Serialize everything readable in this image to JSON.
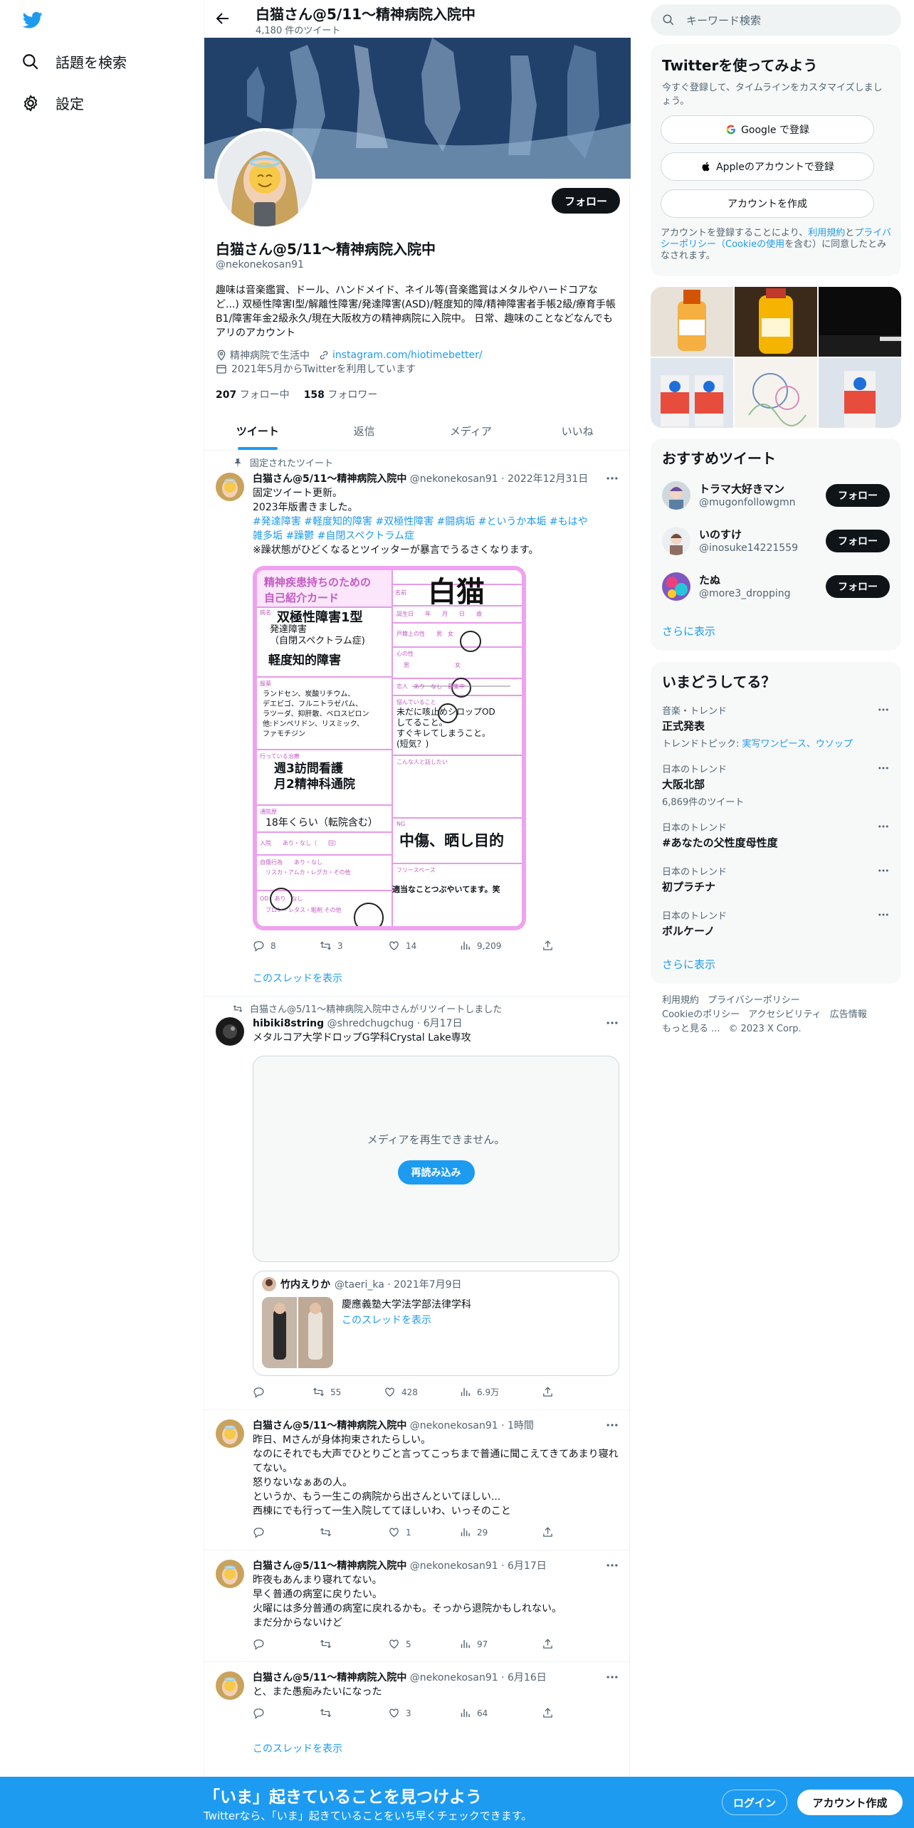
{
  "colors": {
    "accent": "#1d9bf0",
    "text": "#0f1419",
    "muted": "#536471",
    "card_pink": "#f0a2f0"
  },
  "nav": {
    "logo_icon": "twitter-bird-icon",
    "items": [
      {
        "label": "話題を検索",
        "icon": "search-icon"
      },
      {
        "label": "設定",
        "icon": "gear-icon"
      }
    ]
  },
  "header": {
    "title": "白猫さん@5/11〜精神病院入院中",
    "tweet_count": "4,180 件のツイート"
  },
  "profile": {
    "follow": "フォロー",
    "name": "白猫さん@5/11〜精神病院入院中",
    "handle": "@nekonekosan91",
    "bio": "趣味は音楽鑑賞、ドール、ハンドメイド、ネイル等(音楽鑑賞はメタルやハードコアなど...) 双極性障害Ⅰ型/解離性障害/発達障害(ASD)/軽度知的障/精神障害者手帳2級/療育手帳B1/障害年金2級永久/現在大阪枚方の精神病院に入院中。 日常、趣味のことなどなんでもアリのアカウント",
    "location": "精神病院で生活中",
    "link": "instagram.com/hiotimebetter/",
    "joined": "2021年5月からTwitterを利用しています",
    "following_count": "207",
    "following_label": "フォロー中",
    "followers_count": "158",
    "followers_label": "フォロワー"
  },
  "tabs": [
    "ツイート",
    "返信",
    "メディア",
    "いいね"
  ],
  "tweets": [
    {
      "pinned": "固定されたツイート",
      "name": "白猫さん@5/11〜精神病院入院中",
      "meta": "@nekonekosan91 · 2022年12月31日",
      "line1": "固定ツイート更新。",
      "line2": "2023年版書きました。",
      "tags1": "#発達障害 #軽度知的障害 #双極性障害 #闘病垢 #というか本垢 #もはや",
      "tags2": "雑多垢 #躁鬱 #自閉スペクトラム症",
      "line3": "※躁状態がひどくなるとツイッターが暴言でうるさくなります。",
      "replies": "8",
      "retweets": "3",
      "likes": "14",
      "views": "9,209",
      "thread": "このスレッドを表示",
      "card": {
        "title": "精神疾患持ちのための\n自己紹介カード",
        "name_label": "名前",
        "name": "白猫",
        "illness_label": "病名",
        "illness1": "双極性障害1型",
        "illness2": "発達障害\n（自閉スペクトラム症)",
        "illness3": "軽度知的障害",
        "birthday": "誕生日　　年　　月　　日　　歳",
        "sex": "戸籍上の性　　男　女",
        "mind": "心の性",
        "mind_scale": "男　　　　　　　　女",
        "partner": "恋人　あり　なし　募集中",
        "med_label": "服薬",
        "meds": "ランドセン、炭酸リチウム、\nデエビゴ、フルニトラゼパム、\nラツーダ、抑肝散、ベロスピロン\n他:ドンペリドン、リスミック、\nファモチジン",
        "worry_label": "悩んでいること",
        "worry": "未だに咳止めシロップOD\nしてること。\nすぐキレてしまうこと。\n(短気？)",
        "treat_label": "行っている治療",
        "treat": "週3訪問看護\n月2精神科通院",
        "talk": "こんな人と話したい",
        "hist_label": "通院歴",
        "hist": "18年くらい（転院含む）",
        "ng_label": "NG",
        "ng": "中傷、晒し目的",
        "hosp": "入院　　あり・なし（　　回）",
        "self": "自傷行為　　あり・なし\n　リスカ・アムカ・レグカ・その他",
        "free_label": "フリースペース",
        "free": "適当なことつぶやいてます。笑",
        "od": "OD　あり　なし\n　ブロン・レタス・眠剤 その他"
      }
    },
    {
      "rt_by": "白猫さん@5/11〜精神病院入院中さんがリツイートしました",
      "name": "hibiki8string",
      "meta": "@shredchugchug · 6月17日",
      "text": "メタルコア大学ドロップG学科Crystal Lake専攻",
      "media_msg": "メディアを再生できません。",
      "retry": "再読み込み",
      "quote_name": "竹内えりか",
      "quote_meta": "@taeri_ka · 2021年7月9日",
      "quote_text": "慶應義塾大学法学部法律学科",
      "quote_thread": "このスレッドを表示",
      "replies": "",
      "retweets": "55",
      "likes": "428",
      "views": "6.9万"
    },
    {
      "name": "白猫さん@5/11〜精神病院入院中",
      "meta": "@nekonekosan91 · 1時間",
      "text": "昨日、Mさんが身体拘束されたらしい。\nなのにそれでも大声でひとりごと言ってこっちまで普通に聞こえてきてあまり寝れてない。\n怒りないなぁあの人。\nというか、もう一生この病院から出さんといてほしい...\n西棟にでも行って一生入院しててほしいわ、いっそのこと",
      "replies": "",
      "retweets": "",
      "likes": "1",
      "views": "29"
    },
    {
      "name": "白猫さん@5/11〜精神病院入院中",
      "meta": "@nekonekosan91 · 6月17日",
      "text": "昨夜もあんまり寝れてない。\n早く普通の病室に戻りたい。\n火曜には多分普通の病室に戻れるかも。そっから退院かもしれない。\nまだ分からないけど",
      "replies": "",
      "retweets": "",
      "likes": "5",
      "views": "97"
    },
    {
      "name": "白猫さん@5/11〜精神病院入院中",
      "meta": "@nekonekosan91 · 6月16日",
      "text": "と、また愚痴みたいになった",
      "replies": "",
      "retweets": "",
      "likes": "3",
      "views": "64",
      "thread": "このスレッドを表示"
    }
  ],
  "right": {
    "search_placeholder": "キーワード検索",
    "signup": {
      "title": "Twitterを使ってみよう",
      "sub": "今すぐ登録して、タイムラインをカスタマイズしましょう。",
      "google": "Google で登録",
      "apple": "Appleのアカウントで登録",
      "create": "アカウントを作成",
      "terms_a": "アカウントを登録することにより、",
      "terms_b": "利用規約",
      "terms_c": "と",
      "terms_d": "プライバシーポリシー（Cookieの使用",
      "terms_e": "を含む）に同意したとみなされます。"
    },
    "recommend": {
      "title": "おすすめツイート",
      "users": [
        {
          "name": "トラマ大好きマン",
          "handle": "@mugonfollowgmn"
        },
        {
          "name": "いのすけ",
          "handle": "@inosuke14221559"
        },
        {
          "name": "たぬ",
          "handle": "@more3_dropping"
        }
      ],
      "follow": "フォロー",
      "more": "さらに表示"
    },
    "trends": {
      "title": "いまどうしてる？",
      "items": [
        {
          "cat": "音楽・トレンド",
          "title": "正式発表",
          "sub": "トレンドトピック: ",
          "sub_links": "実写ワンピース、ウソップ"
        },
        {
          "cat": "日本のトレンド",
          "title": "大阪北部",
          "sub": "6,869件のツイート"
        },
        {
          "cat": "日本のトレンド",
          "title": "#あなたの父性度母性度",
          "sub": ""
        },
        {
          "cat": "日本のトレンド",
          "title": "初プラチナ",
          "sub": ""
        },
        {
          "cat": "日本のトレンド",
          "title": "ボルケーノ",
          "sub": ""
        }
      ],
      "more": "さらに表示"
    },
    "footer": {
      "l1": "利用規約",
      "l2": "プライバシーポリシー",
      "l3": "Cookieのポリシー",
      "l4": "アクセシビリティ",
      "l5": "広告情報",
      "l6": "もっと見る ...",
      "l7": "© 2023 X Corp."
    }
  },
  "bottom": {
    "title": "「いま」起きていることを見つけよう",
    "sub": "Twitterなら、「いま」起きていることをいち早くチェックできます。",
    "login": "ログイン",
    "signup": "アカウント作成"
  }
}
